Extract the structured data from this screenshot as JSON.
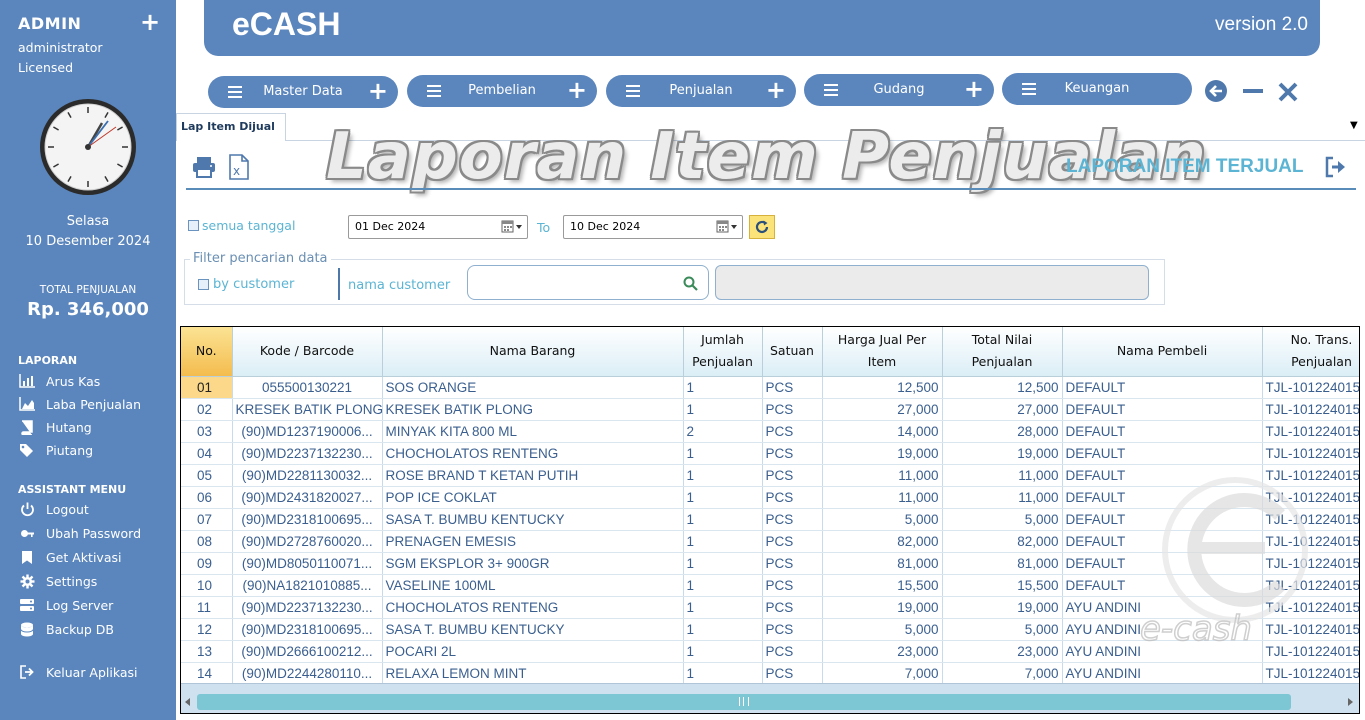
{
  "sidebar": {
    "user": "ADMIN",
    "plus": "+",
    "role": "administrator",
    "license": "Licensed",
    "day": "Selasa",
    "date": "10 Desember 2024",
    "total_label": "TOTAL PENJUALAN",
    "total_value": "Rp. 346,000",
    "laporan_title": "LAPORAN",
    "laporan_items": [
      {
        "label": "Arus Kas",
        "icon": "bar-chart-icon"
      },
      {
        "label": "Laba Penjualan",
        "icon": "area-chart-icon"
      },
      {
        "label": "Hutang",
        "icon": "book-icon"
      },
      {
        "label": "Piutang",
        "icon": "tags-icon"
      }
    ],
    "assistant_title": "ASSISTANT MENU",
    "assistant_items": [
      {
        "label": "Logout",
        "icon": "power-icon"
      },
      {
        "label": "Ubah Password",
        "icon": "key-icon"
      },
      {
        "label": "Get Aktivasi",
        "icon": "bookmark-icon"
      },
      {
        "label": "Settings",
        "icon": "gear-icon"
      },
      {
        "label": "Log Server",
        "icon": "server-icon"
      },
      {
        "label": "Backup DB",
        "icon": "database-icon"
      }
    ],
    "exit_label": "Keluar Aplikasi"
  },
  "header": {
    "title": "eCASH",
    "version": "version 2.0"
  },
  "menu": [
    {
      "label": "Master Data"
    },
    {
      "label": "Pembelian"
    },
    {
      "label": "Penjualan"
    },
    {
      "label": "Gudang"
    },
    {
      "label": "Keuangan"
    }
  ],
  "menu_plus": "+",
  "tab": {
    "label": "Lap Item Dijual"
  },
  "report": {
    "big_title": "Laporan Item Penjualan",
    "sub_title": "LAPORAN ITEM TERJUAL"
  },
  "filters": {
    "all_dates_label": "semua tanggal",
    "date_from": "01 Dec  2024",
    "to_label": "To",
    "date_to": "10 Dec  2024",
    "group_label": "Filter pencarian data",
    "by_customer_label": "by customer",
    "customer_name_label": "nama customer",
    "customer_search_value": "",
    "customer_readonly_value": ""
  },
  "table": {
    "columns": [
      [
        "No.",
        ""
      ],
      [
        "Kode / Barcode",
        ""
      ],
      [
        "Nama Barang",
        ""
      ],
      [
        "Jumlah",
        "Penjualan"
      ],
      [
        "Satuan",
        ""
      ],
      [
        "Harga Jual Per",
        "Item"
      ],
      [
        "Total Nilai",
        "Penjualan"
      ],
      [
        "Nama Pembeli",
        ""
      ],
      [
        "No. Trans.",
        "Penjualan"
      ]
    ],
    "rows": [
      [
        "01",
        "055500130221",
        "SOS ORANGE",
        "1",
        "PCS",
        "12,500",
        "12,500",
        "DEFAULT",
        "TJL-101224015"
      ],
      [
        "02",
        "KRESEK BATIK PLONG",
        "KRESEK BATIK PLONG",
        "1",
        "PCS",
        "27,000",
        "27,000",
        "DEFAULT",
        "TJL-101224015"
      ],
      [
        "03",
        "(90)MD1237190006...",
        "MINYAK KITA 800 ML",
        "2",
        "PCS",
        "14,000",
        "28,000",
        "DEFAULT",
        "TJL-101224015"
      ],
      [
        "04",
        "(90)MD2237132230...",
        "CHOCHOLATOS RENTENG",
        "1",
        "PCS",
        "19,000",
        "19,000",
        "DEFAULT",
        "TJL-101224015"
      ],
      [
        "05",
        "(90)MD2281130032...",
        "ROSE BRAND T KETAN PUTIH",
        "1",
        "PCS",
        "11,000",
        "11,000",
        "DEFAULT",
        "TJL-101224015"
      ],
      [
        "06",
        "(90)MD2431820027...",
        "POP ICE COKLAT",
        "1",
        "PCS",
        "11,000",
        "11,000",
        "DEFAULT",
        "TJL-101224015"
      ],
      [
        "07",
        "(90)MD2318100695...",
        "SASA T. BUMBU KENTUCKY",
        "1",
        "PCS",
        "5,000",
        "5,000",
        "DEFAULT",
        "TJL-101224015"
      ],
      [
        "08",
        "(90)MD2728760020...",
        "PRENAGEN EMESIS",
        "1",
        "PCS",
        "82,000",
        "82,000",
        "DEFAULT",
        "TJL-101224015"
      ],
      [
        "09",
        "(90)MD8050110071...",
        "SGM EKSPLOR 3+ 900GR",
        "1",
        "PCS",
        "81,000",
        "81,000",
        "DEFAULT",
        "TJL-101224015"
      ],
      [
        "10",
        "(90)NA1821010885...",
        "VASELINE 100ML",
        "1",
        "PCS",
        "15,500",
        "15,500",
        "DEFAULT",
        "TJL-101224015"
      ],
      [
        "11",
        "(90)MD2237132230...",
        "CHOCHOLATOS RENTENG",
        "1",
        "PCS",
        "19,000",
        "19,000",
        "AYU ANDINI",
        "TJL-101224015"
      ],
      [
        "12",
        "(90)MD2318100695...",
        "SASA T. BUMBU KENTUCKY",
        "1",
        "PCS",
        "5,000",
        "5,000",
        "AYU ANDINI",
        "TJL-101224015"
      ],
      [
        "13",
        "(90)MD2666100212...",
        "POCARI 2L",
        "1",
        "PCS",
        "23,000",
        "23,000",
        "AYU ANDINI",
        "TJL-101224015"
      ],
      [
        "14",
        "(90)MD2244280110...",
        "RELAXA LEMON MINT",
        "1",
        "PCS",
        "7,000",
        "7,000",
        "AYU ANDINI",
        "TJL-101224015"
      ]
    ]
  },
  "colors": {
    "primary": "#5b86bd",
    "accent_text": "#5bb4d3",
    "selected_row": "#fbd88a"
  }
}
